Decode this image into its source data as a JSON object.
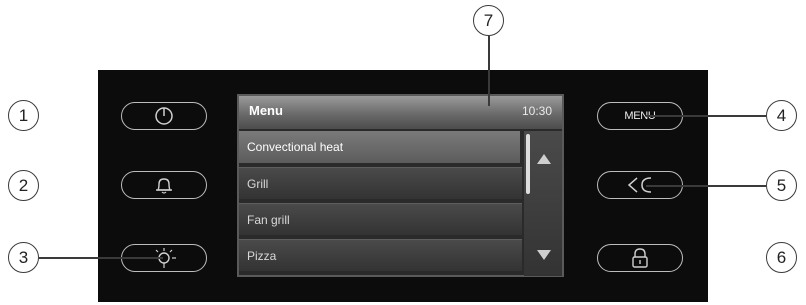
{
  "screen": {
    "title": "Menu",
    "time": "10:30",
    "menu_items": [
      {
        "label": "Convectional heat",
        "selected": true
      },
      {
        "label": "Grill",
        "selected": false
      },
      {
        "label": "Fan grill",
        "selected": false
      },
      {
        "label": "Pizza",
        "selected": false
      }
    ]
  },
  "buttons": {
    "power": {
      "icon": "power-icon"
    },
    "timer": {
      "icon": "bell-icon"
    },
    "light": {
      "icon": "light-bulb-icon"
    },
    "menu": {
      "label": "MENU"
    },
    "back": {
      "icon": "back-icon"
    },
    "lock": {
      "icon": "padlock-icon"
    }
  },
  "callouts": [
    "1",
    "2",
    "3",
    "4",
    "5",
    "6",
    "7"
  ],
  "colors": {
    "panel": "#0c0c0c",
    "screen_selected": "#6e6e6e",
    "outline": "#bdbdbd"
  }
}
